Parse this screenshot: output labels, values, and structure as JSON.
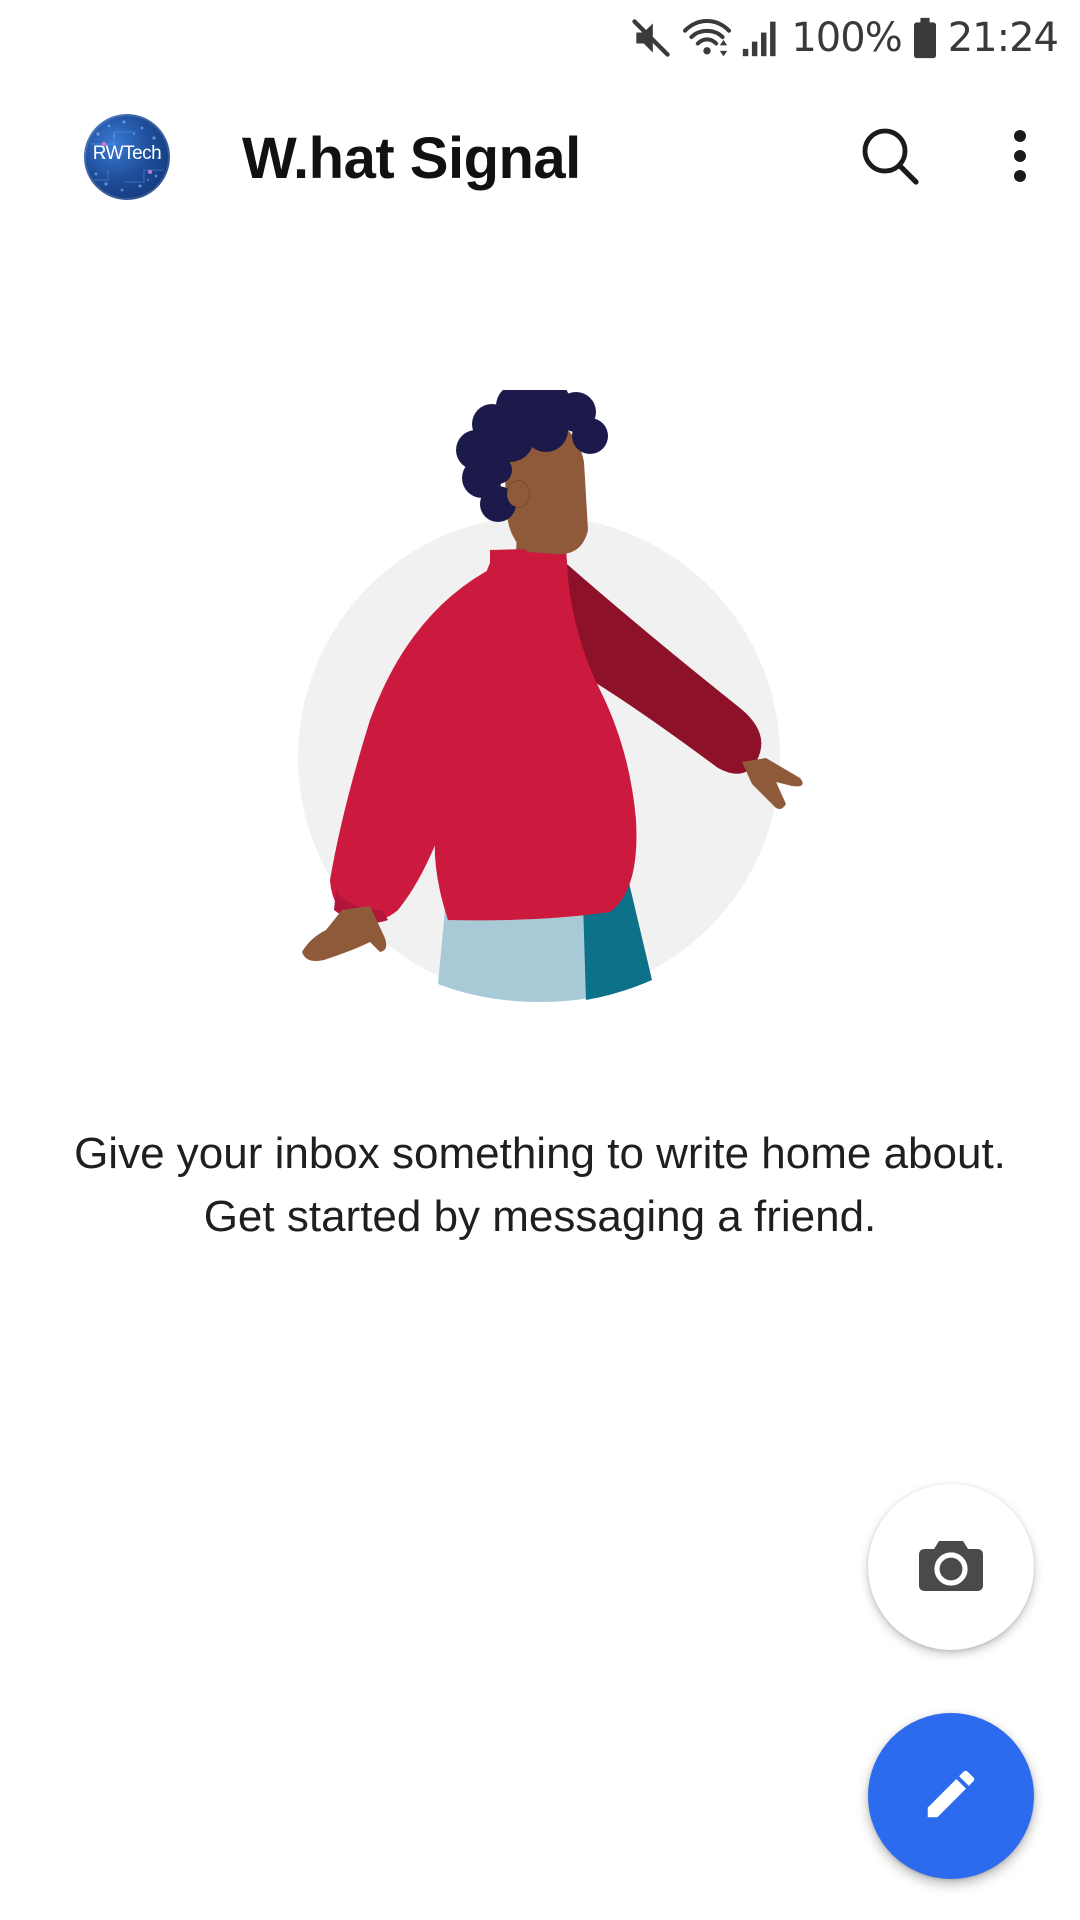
{
  "status_bar": {
    "battery_text": "100%",
    "time": "21:24",
    "icons": [
      "mute-icon",
      "wifi-icon",
      "signal-icon",
      "battery-icon"
    ]
  },
  "app_bar": {
    "avatar_text": "RWTech",
    "title": "W.hat Signal",
    "search_icon": "search-icon",
    "menu_icon": "more-vert-icon"
  },
  "empty_state": {
    "message": "Give your inbox something to write home about. Get started by messaging a friend."
  },
  "fabs": {
    "camera_icon": "camera-icon",
    "compose_icon": "pencil-icon",
    "compose_color": "#2c6bed"
  },
  "colors": {
    "accent": "#2c6bed",
    "sweater": "#cc1a3f",
    "sweater_dark": "#8c1129",
    "skin": "#8e5a3a",
    "hair": "#1b1a4a",
    "pants_light": "#a8c9d6",
    "pants_dark": "#0d7189",
    "circle_bg": "#f1f1f1"
  }
}
